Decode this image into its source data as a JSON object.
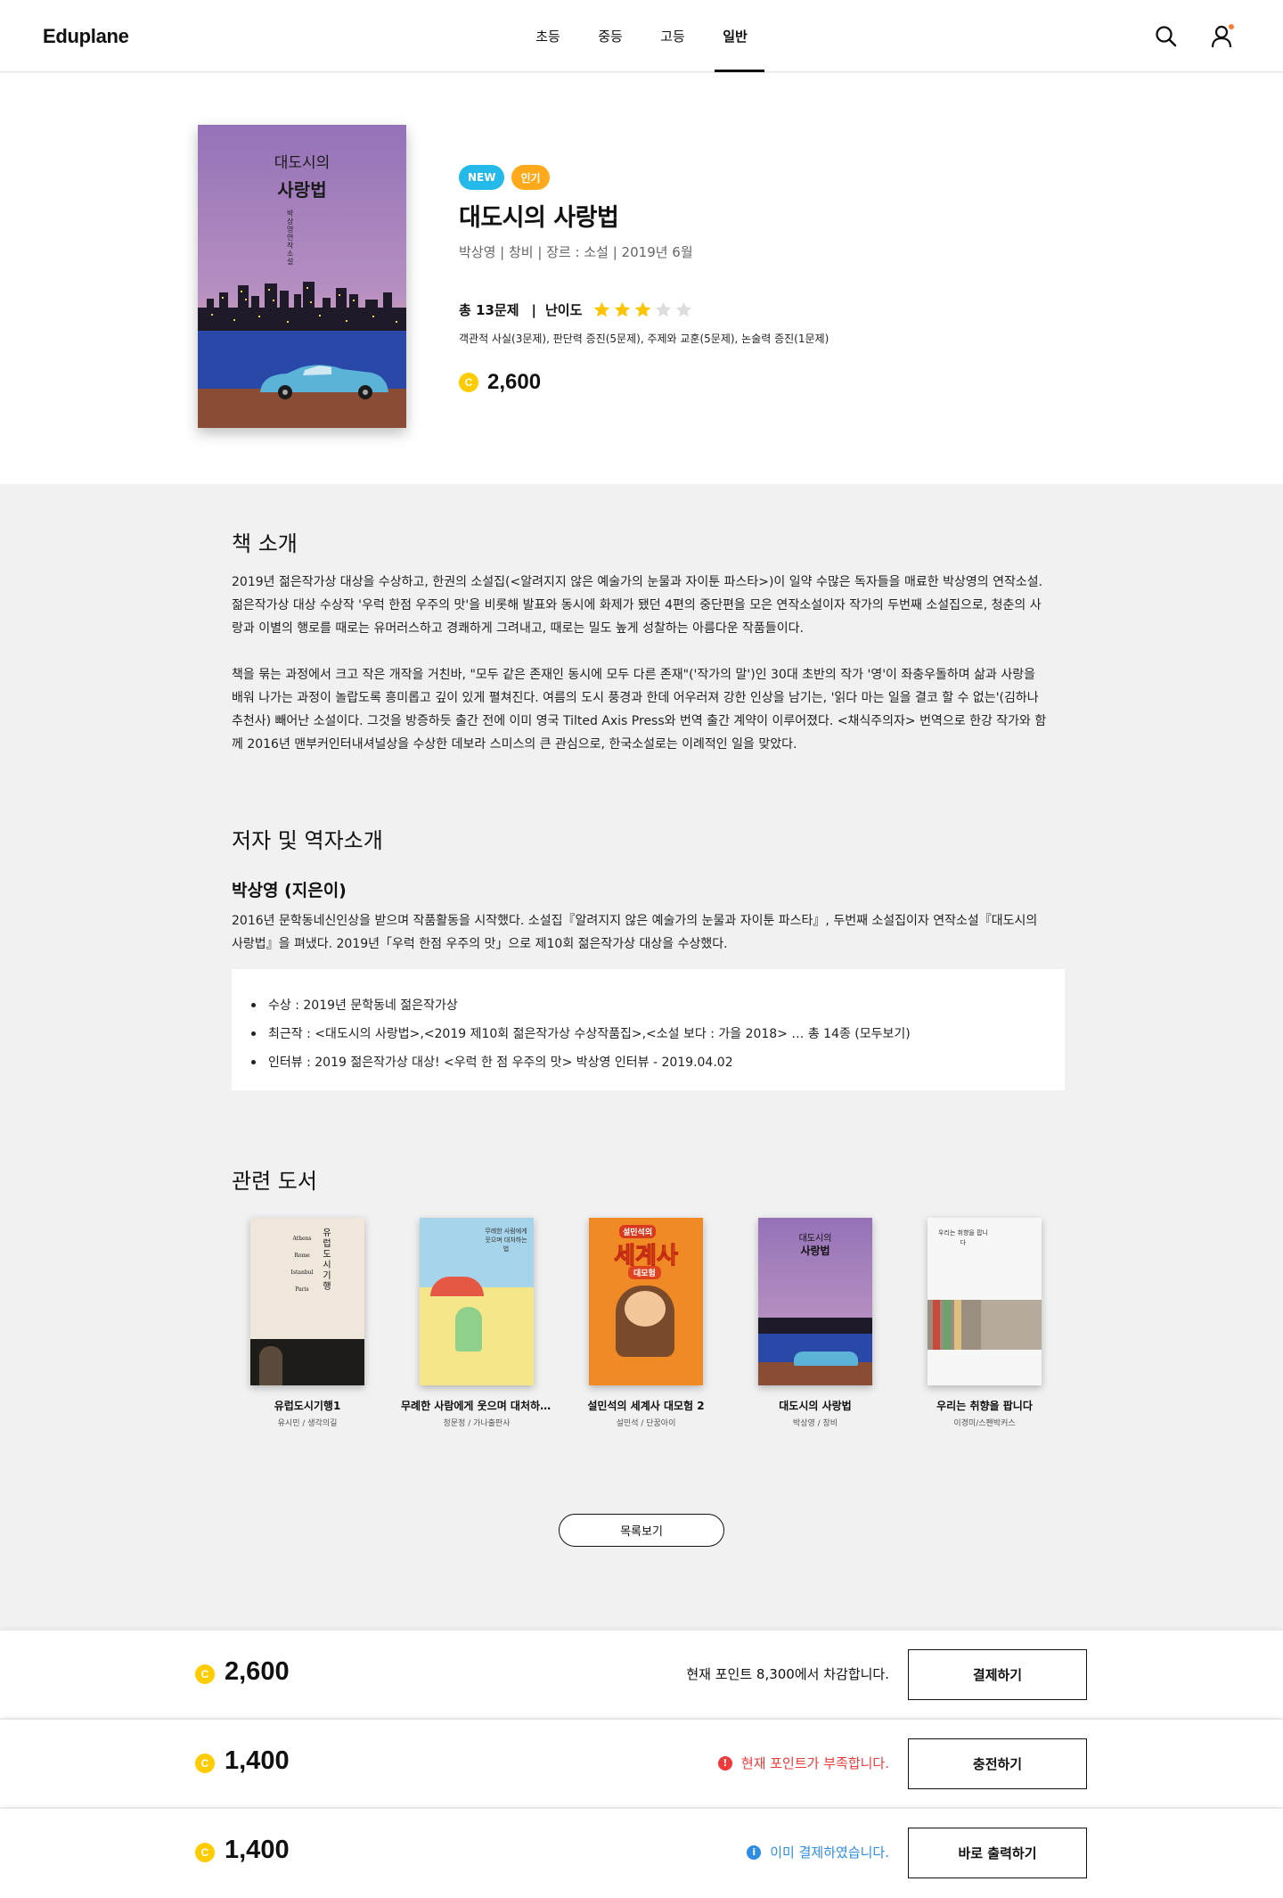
{
  "header": {
    "logo": "Eduplane",
    "nav": [
      {
        "label": "초등"
      },
      {
        "label": "중등"
      },
      {
        "label": "고등"
      },
      {
        "label": "일반"
      }
    ],
    "active_nav": "일반"
  },
  "book": {
    "cover_title_line1": "대도시의",
    "cover_title_line2": "사랑법",
    "cover_author_vertical": "박상영 연작소설",
    "badges": {
      "new": "NEW",
      "hot": "인기"
    },
    "title": "대도시의 사랑법",
    "meta": "박상영 | 창비 | 장르 : 소설 | 2019년 6월",
    "question_total": "총 13문제",
    "separator": "|",
    "difficulty_label": "난이도",
    "difficulty_rating": 3,
    "difficulty_max": 5,
    "question_detail": "객관적 사실(3문제), 판단력 증진(5문제), 주제와 교훈(5문제), 논술력 증진(1문제)",
    "price": "2,600",
    "coin_symbol": "C"
  },
  "intro": {
    "title": "책 소개",
    "paragraph1": "2019년 젊은작가상 대상을 수상하고, 한권의 소설집(<알려지지 않은 예술가의 눈물과 자이툰 파스타>)이 일약 수많은 독자들을 매료한 박상영의 연작소설. 젊은작가상 대상 수상작 '우럭 한점 우주의 맛'을 비롯해 발표와 동시에 화제가 됐던 4편의 중단편을 모은 연작소설이자 작가의 두번째 소설집으로, 청춘의 사랑과 이별의 행로를 때로는 유머러스하고 경쾌하게 그려내고, 때로는 밀도 높게 성찰하는 아름다운 작품들이다.",
    "paragraph2": "책을 묶는 과정에서 크고 작은 개작을 거친바, \"모두 같은 존재인 동시에 모두 다른 존재\"('작가의 말')인 30대 초반의 작가 '영'이 좌충우돌하며 삶과 사랑을 배워 나가는 과정이 놀랍도록 흥미롭고 깊이 있게 펼쳐진다. 여름의 도시 풍경과 한데 어우러져 강한 인상을 남기는, '읽다 마는 일을 결코 할 수 없는'(김하나 추천사) 빼어난 소설이다. 그것을 방증하듯 출간 전에 이미 영국 Tilted Axis Press와 번역 출간 계약이 이루어졌다. <채식주의자> 번역으로 한강 작가와 함께 2016년 맨부커인터내셔널상을 수상한 데보라 스미스의 큰 관심으로, 한국소설로는 이례적인 일을 맞았다."
  },
  "author": {
    "section_title": "저자 및 역자소개",
    "name": "박상영 (지은이)",
    "bio": "2016년 문학동네신인상을 받으며 작품활동을 시작했다. 소설집『알려지지 않은 예술가의 눈물과 자이툰 파스타』, 두번째 소설집이자 연작소설『대도시의 사랑법』을 펴냈다. 2019년「우럭 한점 우주의 맛」으로 제10회 젊은작가상 대상을 수상했다.",
    "facts": [
      "수상 : 2019년 문학동네 젊은작가상",
      "최근작 : <대도시의 사랑법>,<2019 제10회 젊은작가상 수상작품집>,<소설 보다 : 가을 2018> … 총 14종 (모두보기)",
      "인터뷰 : 2019 젊은작가상 대상! <우럭 한 점 우주의 맛> 박상영 인터뷰 - 2019.04.02"
    ]
  },
  "related": {
    "title": "관련 도서",
    "books": [
      {
        "title": "유럽도시기행1",
        "author": "유시민 / 생각의길",
        "color": "#efe6dc"
      },
      {
        "title": "무례한 사람에게 웃으며 대처하는 법",
        "author": "정문정 / 가나출판사",
        "color": "#f3ecc9"
      },
      {
        "title": "설민석의 세계사 대모험 2",
        "author": "설민석 / 단꿈아이",
        "color": "#f08a24"
      },
      {
        "title": "대도시의 사랑법",
        "author": "박상영 / 창비",
        "color": "#9b78b8"
      },
      {
        "title": "우리는 취향을 팝니다",
        "author": "이경미/스펜박커스",
        "color": "#f7f7f7"
      }
    ],
    "cover_texts": {
      "europe": "유럽도시기행",
      "europe_cities": [
        "Athens",
        "Rome",
        "Istanbul",
        "Paris"
      ],
      "rude": "무례한 사람에게 웃으며 대처하는 법",
      "history_series": "설민석의",
      "history_title": "세계사",
      "history_sub": "대모험",
      "taste": "우리는 취향을 팝니다"
    },
    "list_button": "목록보기"
  },
  "payments": [
    {
      "price": "2,600",
      "message": "현재 포인트 8,300에서 차감합니다.",
      "type": "normal",
      "button": "결제하기"
    },
    {
      "price": "1,400",
      "message": "현재 포인트가 부족합니다.",
      "type": "warn",
      "button": "충전하기",
      "icon": "!"
    },
    {
      "price": "1,400",
      "message": "이미 결제하였습니다.",
      "type": "info",
      "button": "바로 출력하기",
      "icon": "i"
    }
  ],
  "colors": {
    "new_badge": "#23b9e8",
    "hot_badge": "#ffa91b",
    "coin": "#ffcc00",
    "star": "#ffc400",
    "star_empty": "#dddddd",
    "warn": "#f03a3a",
    "info": "#2c8de5",
    "notification_dot": "#ff7a2f"
  }
}
